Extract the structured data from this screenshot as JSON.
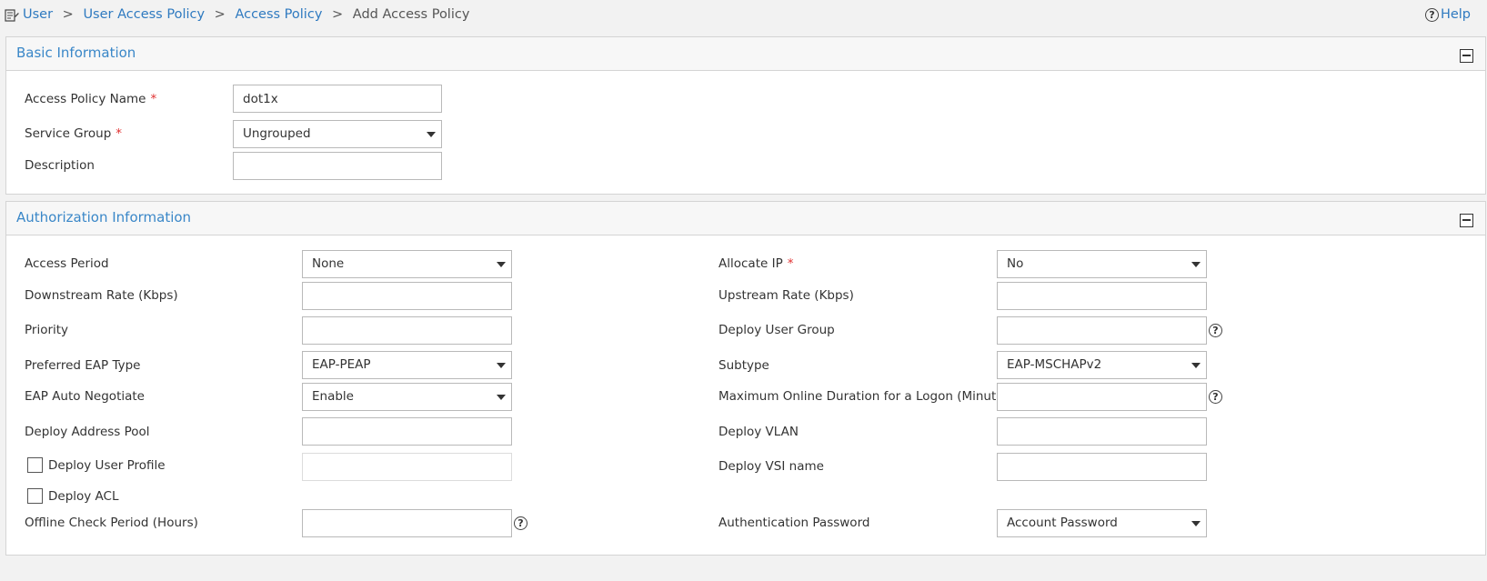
{
  "breadcrumb": {
    "items": [
      "User",
      "User Access Policy",
      "Access Policy"
    ],
    "separator": ">",
    "current": "Add Access Policy"
  },
  "help_label": "Help",
  "basic": {
    "title": "Basic Information",
    "policy_name_label": "Access Policy Name",
    "policy_name_value": "dot1x",
    "service_group_label": "Service Group",
    "service_group_value": "Ungrouped",
    "description_label": "Description",
    "description_value": "",
    "required_mark": "*"
  },
  "auth": {
    "title": "Authorization Information",
    "access_period_label": "Access Period",
    "access_period_value": "None",
    "downstream_label": "Downstream Rate (Kbps)",
    "downstream_value": "",
    "priority_label": "Priority",
    "priority_value": "",
    "eap_type_label": "Preferred EAP Type",
    "eap_type_value": "EAP-PEAP",
    "eap_auto_label": "EAP Auto Negotiate",
    "eap_auto_value": "Enable",
    "address_pool_label": "Deploy Address Pool",
    "address_pool_value": "",
    "user_profile_label": "Deploy User Profile",
    "user_profile_value": "",
    "acl_label": "Deploy ACL",
    "offline_check_label": "Offline Check Period (Hours)",
    "offline_check_value": "",
    "allocate_ip_label": "Allocate IP",
    "allocate_ip_value": "No",
    "upstream_label": "Upstream Rate (Kbps)",
    "upstream_value": "",
    "user_group_label": "Deploy User Group",
    "user_group_value": "",
    "subtype_label": "Subtype",
    "subtype_value": "EAP-MSCHAPv2",
    "max_online_label": "Maximum Online Duration for a Logon (Minutes)",
    "max_online_value": "",
    "vlan_label": "Deploy VLAN",
    "vlan_value": "",
    "vsi_label": "Deploy VSI name",
    "vsi_value": "",
    "auth_password_label": "Authentication Password",
    "auth_password_value": "Account Password",
    "required_mark": "*"
  },
  "help_glyph": "?",
  "colors": {
    "link": "#2f7ac0",
    "title": "#3a87c8",
    "required": "#e03030",
    "background": "#f2f2f2"
  }
}
